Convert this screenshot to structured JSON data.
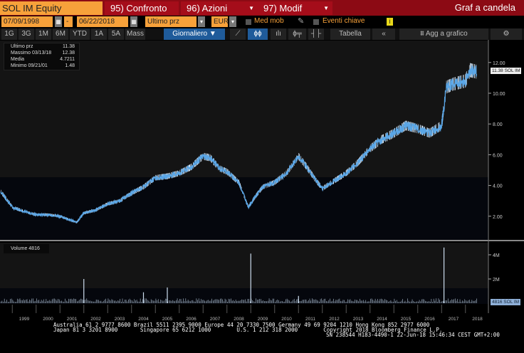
{
  "header": {
    "ticker": "SOL IM Equity",
    "compare": "95) Confronto",
    "actions": "96) Azioni",
    "modify": "97) Modif",
    "chart_type": "Graf a candela"
  },
  "controls": {
    "start_date": "07/09/1998",
    "dash": "-",
    "end_date": "06/22/2018",
    "field": "Ultimo prz",
    "currency": "EUR",
    "moving_avg": "Med mob",
    "key_events": "Eventi chiave",
    "info": "i"
  },
  "periods": [
    "1G",
    "3G",
    "1M",
    "6M",
    "YTD",
    "1A",
    "5A",
    "Mass"
  ],
  "frequency": "Giornaliero ▼",
  "toolbar": {
    "table": "Tabella",
    "collapse": "«",
    "add_to_chart": "Agg a grafico",
    "settings": "⚙"
  },
  "legend": [
    {
      "label": "Ultimo prz",
      "value": "11.38"
    },
    {
      "label": "Massimo 03/13/18",
      "value": "12.38"
    },
    {
      "label": "Media",
      "value": "4.7211"
    },
    {
      "label": "Minimo 09/21/01",
      "value": "1.48"
    }
  ],
  "volume_legend": "Volume 4816",
  "price_tag": "11.38 SOL IM",
  "volume_tag": "4816 SOL IM",
  "colors": {
    "accent": "#f7a13a",
    "bar": "#8c0a14",
    "price": "#5aa6e6"
  },
  "chart_data": {
    "type": "line",
    "price": {
      "yticks": [
        "2.00",
        "4.00",
        "6.00",
        "8.00",
        "10.00",
        "12.00"
      ],
      "ylim": [
        0,
        14
      ],
      "x": [
        1998.52,
        1999,
        1999.5,
        2000,
        2000.5,
        2001,
        2001.7,
        2002,
        2002.5,
        2003,
        2003.5,
        2004,
        2004.5,
        2005,
        2005.5,
        2006,
        2006.5,
        2007,
        2007.3,
        2007.7,
        2008,
        2008.5,
        2008.9,
        2009.2,
        2009.5,
        2010,
        2010.5,
        2011,
        2011.3,
        2011.7,
        2012,
        2012.5,
        2013,
        2013.5,
        2014,
        2014.5,
        2015,
        2015.5,
        2016,
        2016.5,
        2017,
        2017.2,
        2017.5,
        2018,
        2018.2,
        2018.47
      ],
      "y": [
        3.6,
        2.6,
        2.3,
        2.1,
        2.1,
        2.0,
        1.6,
        2.2,
        2.4,
        2.8,
        3.0,
        3.5,
        3.9,
        4.5,
        4.6,
        4.8,
        5.2,
        5.9,
        5.8,
        5.1,
        4.9,
        4.2,
        2.6,
        3.3,
        3.9,
        4.2,
        4.8,
        5.9,
        5.3,
        4.4,
        3.8,
        4.3,
        4.8,
        5.5,
        6.4,
        7.0,
        7.4,
        7.9,
        7.7,
        7.4,
        7.9,
        10.4,
        10.6,
        10.8,
        11.5,
        11.4
      ]
    },
    "volume": {
      "yticks": [
        "2M",
        "4M"
      ],
      "ylim": [
        0,
        5
      ],
      "spikes": [
        {
          "x": 2002.0,
          "v": 2.0
        },
        {
          "x": 2004.5,
          "v": 0.9
        },
        {
          "x": 2005.5,
          "v": 1.3
        },
        {
          "x": 2009.0,
          "v": 4.1
        },
        {
          "x": 2011.0,
          "v": 0.6
        },
        {
          "x": 2017.1,
          "v": 4.6
        }
      ],
      "base": 0.25
    },
    "xticks": [
      "1999",
      "2000",
      "2001",
      "2002",
      "2003",
      "2004",
      "2005",
      "2006",
      "2007",
      "2008",
      "2009",
      "2010",
      "2011",
      "2012",
      "2013",
      "2014",
      "2015",
      "2016",
      "2017",
      "2018"
    ]
  },
  "footer": {
    "line1": "Australia 61 2 9777 8600 Brazil 5511 2395 9000 Europe 44 20 7330 7500 Germany 49 69 9204 1210 Hong Kong 852 2977 6000",
    "line2": "Japan 81 3 3201 8900       Singapore 65 6212 1000        U.S. 1 212 318 2000        Copyright 2018 Bloomberg Finance L.P.",
    "line3": "SN 238544 H183-4490-1 22-Jun-18 15:46:34 CEST GMT+2:00"
  }
}
